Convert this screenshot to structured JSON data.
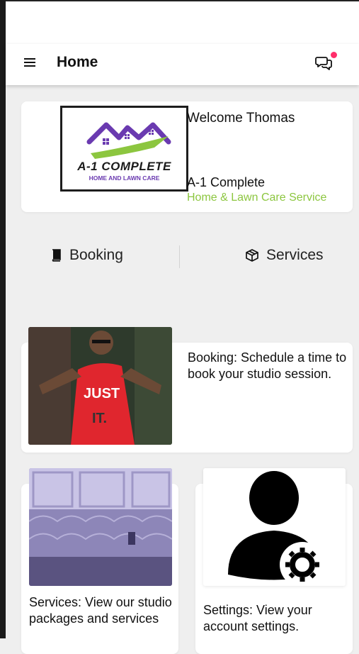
{
  "header": {
    "title": "Home"
  },
  "welcome": {
    "greeting": "Welcome Thomas",
    "company_name": "A-1 Complete",
    "company_subtitle": "Home & Lawn Care Service",
    "logo_text": "A-1 COMPLETE",
    "logo_subtext": "HOME AND LAWN CARE"
  },
  "tabs": [
    {
      "label": "Booking",
      "icon": "book-icon"
    },
    {
      "label": "Services",
      "icon": "box-icon"
    }
  ],
  "cards": {
    "booking": {
      "description": "Booking: Schedule a time to book your studio session."
    },
    "services": {
      "description": "Services: View our studio packages and services"
    },
    "settings": {
      "description": "Settings: View your account settings."
    }
  },
  "colors": {
    "accent_green": "#8cc63f",
    "logo_purple": "#6a3ab0",
    "notification_dot": "#ff2d6a"
  }
}
